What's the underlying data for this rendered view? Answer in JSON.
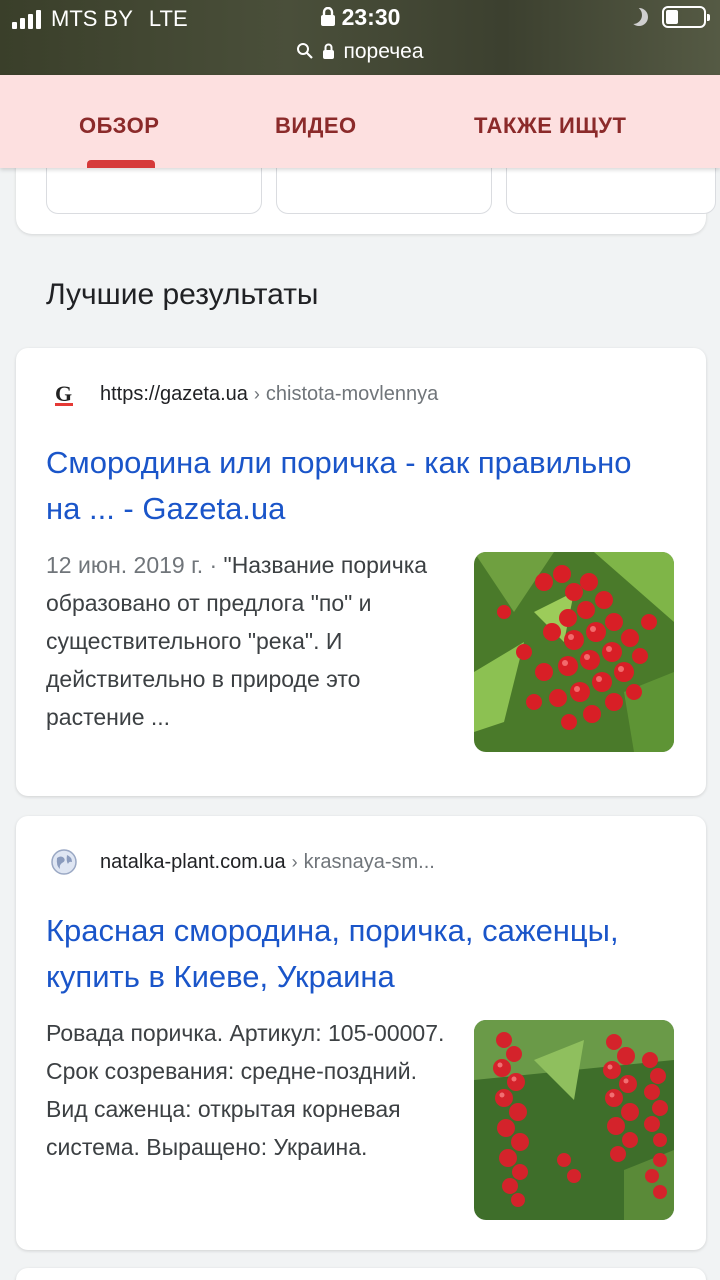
{
  "status": {
    "carrier": "MTS BY",
    "network": "LTE",
    "time": "23:30",
    "url": "поречеа"
  },
  "tabs": [
    {
      "label": "ОБЗОР"
    },
    {
      "label": "ВИДЕО"
    },
    {
      "label": "ТАКЖЕ ИЩУТ"
    }
  ],
  "section_title": "Лучшие результаты",
  "results": [
    {
      "domain": "https://gazeta.ua",
      "path": "chistota-movlennya",
      "title": "Смородина или поричка - как правильно на ... - Gazeta.ua",
      "date": "12 июн. 2019 г. · ",
      "snippet": "\"Название поричка образовано от предлога \"по\" и существительного \"река\". И действительно в природе это растение ..."
    },
    {
      "domain": "natalka-plant.com.ua",
      "path": "krasnaya-sm...",
      "title": "Красная смородина, поричка, саженцы, купить в Киеве, Украина",
      "date": "",
      "snippet": "Ровада поричка. Артикул: 105-00007. Срок созревания: средне-поздний. Вид саженца: открытая корневая система. Выращено: Украина."
    }
  ],
  "colors": {
    "link": "#1a55c9",
    "tab_text": "#8b2a2a",
    "tab_bg": "#fde0e0",
    "tab_indicator": "#d63a3a"
  }
}
